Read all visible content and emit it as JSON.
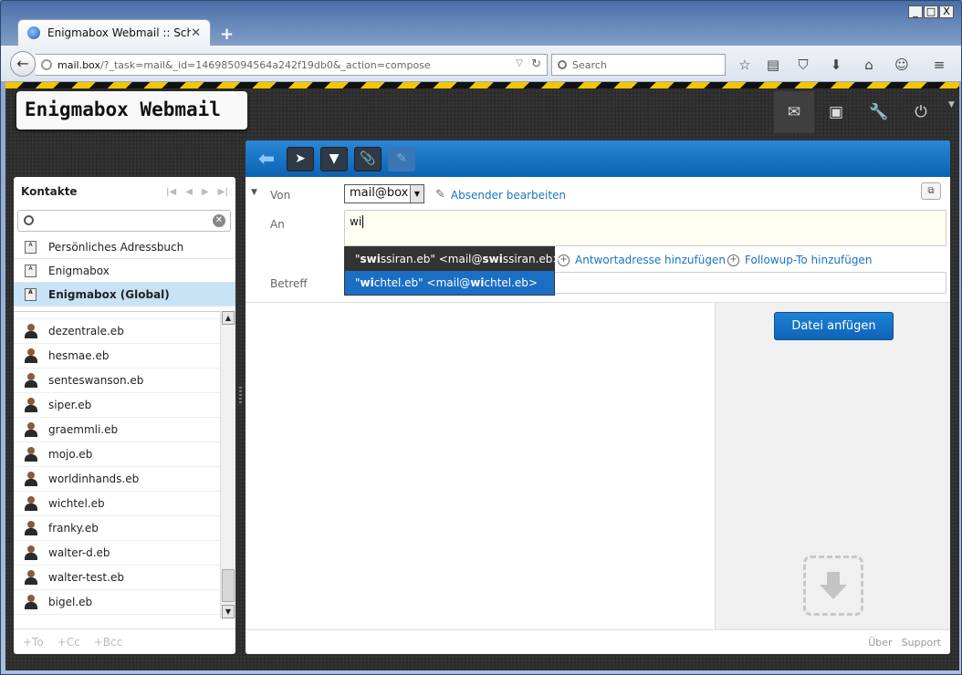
{
  "browser": {
    "tab_title": "Enigmabox Webmail :: Schrei…",
    "url_host": "mail.box",
    "url_path": "/?_task=mail&_id=146985094564a242f19db0&_action=compose",
    "search_placeholder": "Search",
    "window_controls": [
      "_",
      "□",
      "X"
    ]
  },
  "app": {
    "logo": "Enigmabox Webmail",
    "top_icons": [
      "mail-icon",
      "addressbook-icon",
      "settings-icon",
      "logout-icon"
    ]
  },
  "sidebar": {
    "title": "Kontakte",
    "addressbooks": [
      {
        "label": "Persönliches Adressbuch",
        "selected": false
      },
      {
        "label": "Enigmabox",
        "selected": false
      },
      {
        "label": "Enigmabox (Global)",
        "selected": true
      }
    ],
    "contacts": [
      "dezentrale.eb",
      "hesmae.eb",
      "senteswanson.eb",
      "siper.eb",
      "graemmli.eb",
      "mojo.eb",
      "worldinhands.eb",
      "wichtel.eb",
      "franky.eb",
      "walter-d.eb",
      "walter-test.eb",
      "bigel.eb"
    ],
    "footer": {
      "to": "+To",
      "cc": "+Cc",
      "bcc": "+Bcc"
    }
  },
  "compose": {
    "from_label": "Von",
    "from_value": "mail@box",
    "edit_sender": "Absender bearbeiten",
    "to_label": "An",
    "to_value": "wi",
    "add_replyto": "Antwortadresse hinzufügen",
    "add_followup": "Followup-To hinzufügen",
    "subject_label": "Betreff",
    "autocomplete": [
      {
        "pre": "\"",
        "match1": "swi",
        "mid": "ssiran.eb\" <mail@",
        "match2": "swi",
        "post": "ssiran.eb>",
        "selected": false
      },
      {
        "pre": "\"",
        "match1": "wi",
        "mid": "chtel.eb\" <mail@",
        "match2": "wi",
        "post": "chtel.eb>",
        "selected": true
      }
    ],
    "attach_button": "Datei anfügen"
  },
  "footer": {
    "about": "Über",
    "support": "Support"
  },
  "colors": {
    "accent": "#1a6ec4",
    "hazard_yellow": "#f2c600"
  }
}
